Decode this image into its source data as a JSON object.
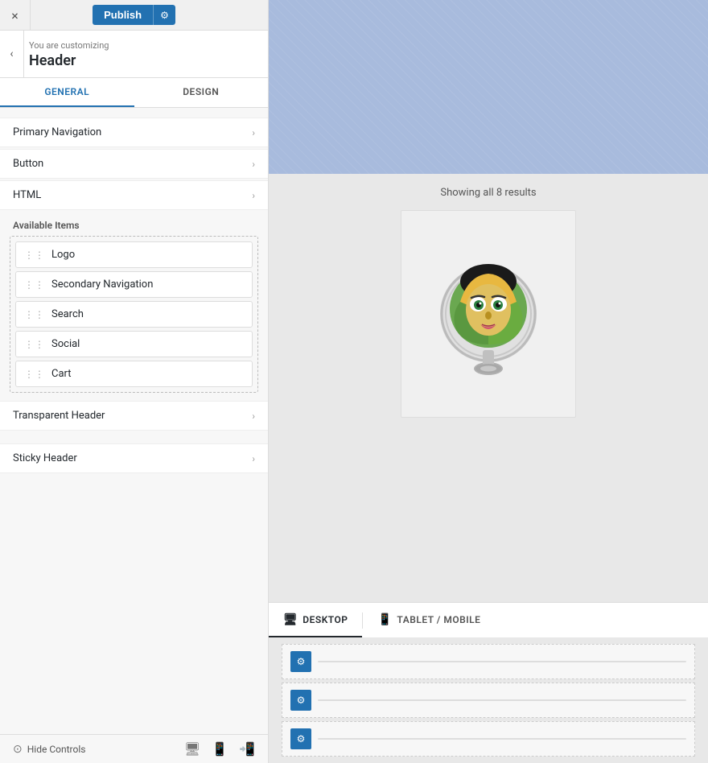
{
  "topbar": {
    "close_icon": "×",
    "publish_label": "Publish",
    "settings_icon": "⚙"
  },
  "context": {
    "customizing_label": "You are customizing",
    "back_icon": "‹",
    "section_title": "Header"
  },
  "tabs": [
    {
      "id": "general",
      "label": "GENERAL",
      "active": true
    },
    {
      "id": "design",
      "label": "DESIGN",
      "active": false
    }
  ],
  "section_rows": [
    {
      "id": "primary-navigation",
      "label": "Primary Navigation"
    },
    {
      "id": "button",
      "label": "Button"
    },
    {
      "id": "html",
      "label": "HTML"
    }
  ],
  "available_items": {
    "label": "Available Items",
    "items": [
      {
        "id": "logo",
        "label": "Logo"
      },
      {
        "id": "secondary-navigation",
        "label": "Secondary Navigation"
      },
      {
        "id": "search",
        "label": "Search"
      },
      {
        "id": "social",
        "label": "Social"
      },
      {
        "id": "cart",
        "label": "Cart"
      }
    ]
  },
  "bottom_sections": [
    {
      "id": "transparent-header",
      "label": "Transparent Header"
    },
    {
      "id": "sticky-header",
      "label": "Sticky Header"
    }
  ],
  "footer": {
    "hide_controls_label": "Hide Controls",
    "icons": [
      "monitor-icon",
      "tablet-icon",
      "phone-icon"
    ]
  },
  "preview": {
    "showing_results": "Showing all 8 results"
  },
  "bottom_tabs": [
    {
      "id": "desktop",
      "label": "DESKTOP",
      "icon": "🖥",
      "active": true
    },
    {
      "id": "tablet-mobile",
      "label": "TABLET / MOBILE",
      "icon": "📱",
      "active": false
    }
  ],
  "settings_rows": [
    {
      "id": "row1"
    },
    {
      "id": "row2"
    },
    {
      "id": "row3"
    }
  ]
}
